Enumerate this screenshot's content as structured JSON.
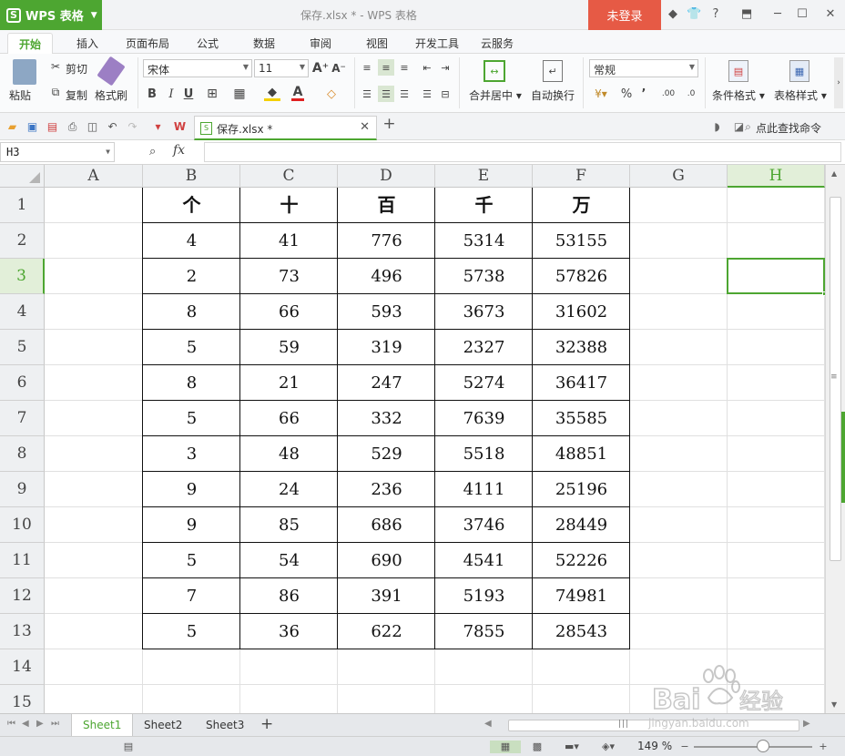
{
  "titlebar": {
    "app_name": "WPS 表格",
    "doc_title": "保存.xlsx * - WPS 表格",
    "login": "未登录"
  },
  "menu_tabs": [
    "开始",
    "插入",
    "页面布局",
    "公式",
    "数据",
    "审阅",
    "视图",
    "开发工具",
    "云服务"
  ],
  "ribbon": {
    "paste": "粘贴",
    "cut": "剪切",
    "copy": "复制",
    "format_painter": "格式刷",
    "font_name": "宋体",
    "font_size": "11",
    "bold": "B",
    "italic": "I",
    "underline": "U",
    "merge_center": "合并居中",
    "wrap_text": "自动换行",
    "number_format": "常规",
    "percent": "%",
    "comma": "’",
    "conditional_format": "条件格式",
    "table_style": "表格样式"
  },
  "quickbar": {
    "doc_tab": "保存.xlsx *",
    "search_command": "点此查找命令"
  },
  "formula_bar": {
    "name_box": "H3",
    "fx": "fx",
    "value": ""
  },
  "grid": {
    "columns": [
      "A",
      "B",
      "C",
      "D",
      "E",
      "F",
      "G",
      "H"
    ],
    "rows": [
      "1",
      "2",
      "3",
      "4",
      "5",
      "6",
      "7",
      "8",
      "9",
      "10",
      "11",
      "12",
      "13",
      "14",
      "15"
    ],
    "selected_cell": "H3",
    "table": {
      "headers": [
        "个",
        "十",
        "百",
        "千",
        "万"
      ],
      "rows": [
        [
          "4",
          "41",
          "776",
          "5314",
          "53155"
        ],
        [
          "2",
          "73",
          "496",
          "5738",
          "57826"
        ],
        [
          "8",
          "66",
          "593",
          "3673",
          "31602"
        ],
        [
          "5",
          "59",
          "319",
          "2327",
          "32388"
        ],
        [
          "8",
          "21",
          "247",
          "5274",
          "36417"
        ],
        [
          "5",
          "66",
          "332",
          "7639",
          "35585"
        ],
        [
          "3",
          "48",
          "529",
          "5518",
          "48851"
        ],
        [
          "9",
          "24",
          "236",
          "4111",
          "25196"
        ],
        [
          "9",
          "85",
          "686",
          "3746",
          "28449"
        ],
        [
          "5",
          "54",
          "690",
          "4541",
          "52226"
        ],
        [
          "7",
          "86",
          "391",
          "5193",
          "74981"
        ],
        [
          "5",
          "36",
          "622",
          "7855",
          "28543"
        ]
      ]
    }
  },
  "sheets": [
    "Sheet1",
    "Sheet2",
    "Sheet3"
  ],
  "active_sheet": "Sheet1",
  "status": {
    "zoom": "149 %"
  },
  "watermark": {
    "brand": "Baidu经验",
    "url": "jingyan.baidu.com"
  },
  "colors": {
    "accent": "#4da631",
    "login_bg": "#e65a45"
  }
}
